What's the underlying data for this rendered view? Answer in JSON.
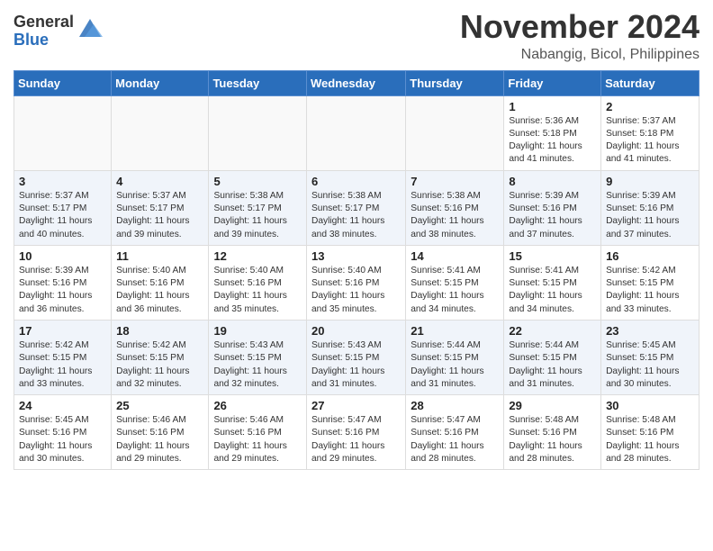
{
  "header": {
    "logo_general": "General",
    "logo_blue": "Blue",
    "month_title": "November 2024",
    "location": "Nabangig, Bicol, Philippines"
  },
  "weekdays": [
    "Sunday",
    "Monday",
    "Tuesday",
    "Wednesday",
    "Thursday",
    "Friday",
    "Saturday"
  ],
  "weeks": [
    [
      {
        "day": "",
        "sunrise": "",
        "sunset": "",
        "daylight": ""
      },
      {
        "day": "",
        "sunrise": "",
        "sunset": "",
        "daylight": ""
      },
      {
        "day": "",
        "sunrise": "",
        "sunset": "",
        "daylight": ""
      },
      {
        "day": "",
        "sunrise": "",
        "sunset": "",
        "daylight": ""
      },
      {
        "day": "",
        "sunrise": "",
        "sunset": "",
        "daylight": ""
      },
      {
        "day": "1",
        "sunrise": "Sunrise: 5:36 AM",
        "sunset": "Sunset: 5:18 PM",
        "daylight": "Daylight: 11 hours and 41 minutes."
      },
      {
        "day": "2",
        "sunrise": "Sunrise: 5:37 AM",
        "sunset": "Sunset: 5:18 PM",
        "daylight": "Daylight: 11 hours and 41 minutes."
      }
    ],
    [
      {
        "day": "3",
        "sunrise": "Sunrise: 5:37 AM",
        "sunset": "Sunset: 5:17 PM",
        "daylight": "Daylight: 11 hours and 40 minutes."
      },
      {
        "day": "4",
        "sunrise": "Sunrise: 5:37 AM",
        "sunset": "Sunset: 5:17 PM",
        "daylight": "Daylight: 11 hours and 39 minutes."
      },
      {
        "day": "5",
        "sunrise": "Sunrise: 5:38 AM",
        "sunset": "Sunset: 5:17 PM",
        "daylight": "Daylight: 11 hours and 39 minutes."
      },
      {
        "day": "6",
        "sunrise": "Sunrise: 5:38 AM",
        "sunset": "Sunset: 5:17 PM",
        "daylight": "Daylight: 11 hours and 38 minutes."
      },
      {
        "day": "7",
        "sunrise": "Sunrise: 5:38 AM",
        "sunset": "Sunset: 5:16 PM",
        "daylight": "Daylight: 11 hours and 38 minutes."
      },
      {
        "day": "8",
        "sunrise": "Sunrise: 5:39 AM",
        "sunset": "Sunset: 5:16 PM",
        "daylight": "Daylight: 11 hours and 37 minutes."
      },
      {
        "day": "9",
        "sunrise": "Sunrise: 5:39 AM",
        "sunset": "Sunset: 5:16 PM",
        "daylight": "Daylight: 11 hours and 37 minutes."
      }
    ],
    [
      {
        "day": "10",
        "sunrise": "Sunrise: 5:39 AM",
        "sunset": "Sunset: 5:16 PM",
        "daylight": "Daylight: 11 hours and 36 minutes."
      },
      {
        "day": "11",
        "sunrise": "Sunrise: 5:40 AM",
        "sunset": "Sunset: 5:16 PM",
        "daylight": "Daylight: 11 hours and 36 minutes."
      },
      {
        "day": "12",
        "sunrise": "Sunrise: 5:40 AM",
        "sunset": "Sunset: 5:16 PM",
        "daylight": "Daylight: 11 hours and 35 minutes."
      },
      {
        "day": "13",
        "sunrise": "Sunrise: 5:40 AM",
        "sunset": "Sunset: 5:16 PM",
        "daylight": "Daylight: 11 hours and 35 minutes."
      },
      {
        "day": "14",
        "sunrise": "Sunrise: 5:41 AM",
        "sunset": "Sunset: 5:15 PM",
        "daylight": "Daylight: 11 hours and 34 minutes."
      },
      {
        "day": "15",
        "sunrise": "Sunrise: 5:41 AM",
        "sunset": "Sunset: 5:15 PM",
        "daylight": "Daylight: 11 hours and 34 minutes."
      },
      {
        "day": "16",
        "sunrise": "Sunrise: 5:42 AM",
        "sunset": "Sunset: 5:15 PM",
        "daylight": "Daylight: 11 hours and 33 minutes."
      }
    ],
    [
      {
        "day": "17",
        "sunrise": "Sunrise: 5:42 AM",
        "sunset": "Sunset: 5:15 PM",
        "daylight": "Daylight: 11 hours and 33 minutes."
      },
      {
        "day": "18",
        "sunrise": "Sunrise: 5:42 AM",
        "sunset": "Sunset: 5:15 PM",
        "daylight": "Daylight: 11 hours and 32 minutes."
      },
      {
        "day": "19",
        "sunrise": "Sunrise: 5:43 AM",
        "sunset": "Sunset: 5:15 PM",
        "daylight": "Daylight: 11 hours and 32 minutes."
      },
      {
        "day": "20",
        "sunrise": "Sunrise: 5:43 AM",
        "sunset": "Sunset: 5:15 PM",
        "daylight": "Daylight: 11 hours and 31 minutes."
      },
      {
        "day": "21",
        "sunrise": "Sunrise: 5:44 AM",
        "sunset": "Sunset: 5:15 PM",
        "daylight": "Daylight: 11 hours and 31 minutes."
      },
      {
        "day": "22",
        "sunrise": "Sunrise: 5:44 AM",
        "sunset": "Sunset: 5:15 PM",
        "daylight": "Daylight: 11 hours and 31 minutes."
      },
      {
        "day": "23",
        "sunrise": "Sunrise: 5:45 AM",
        "sunset": "Sunset: 5:15 PM",
        "daylight": "Daylight: 11 hours and 30 minutes."
      }
    ],
    [
      {
        "day": "24",
        "sunrise": "Sunrise: 5:45 AM",
        "sunset": "Sunset: 5:16 PM",
        "daylight": "Daylight: 11 hours and 30 minutes."
      },
      {
        "day": "25",
        "sunrise": "Sunrise: 5:46 AM",
        "sunset": "Sunset: 5:16 PM",
        "daylight": "Daylight: 11 hours and 29 minutes."
      },
      {
        "day": "26",
        "sunrise": "Sunrise: 5:46 AM",
        "sunset": "Sunset: 5:16 PM",
        "daylight": "Daylight: 11 hours and 29 minutes."
      },
      {
        "day": "27",
        "sunrise": "Sunrise: 5:47 AM",
        "sunset": "Sunset: 5:16 PM",
        "daylight": "Daylight: 11 hours and 29 minutes."
      },
      {
        "day": "28",
        "sunrise": "Sunrise: 5:47 AM",
        "sunset": "Sunset: 5:16 PM",
        "daylight": "Daylight: 11 hours and 28 minutes."
      },
      {
        "day": "29",
        "sunrise": "Sunrise: 5:48 AM",
        "sunset": "Sunset: 5:16 PM",
        "daylight": "Daylight: 11 hours and 28 minutes."
      },
      {
        "day": "30",
        "sunrise": "Sunrise: 5:48 AM",
        "sunset": "Sunset: 5:16 PM",
        "daylight": "Daylight: 11 hours and 28 minutes."
      }
    ]
  ]
}
